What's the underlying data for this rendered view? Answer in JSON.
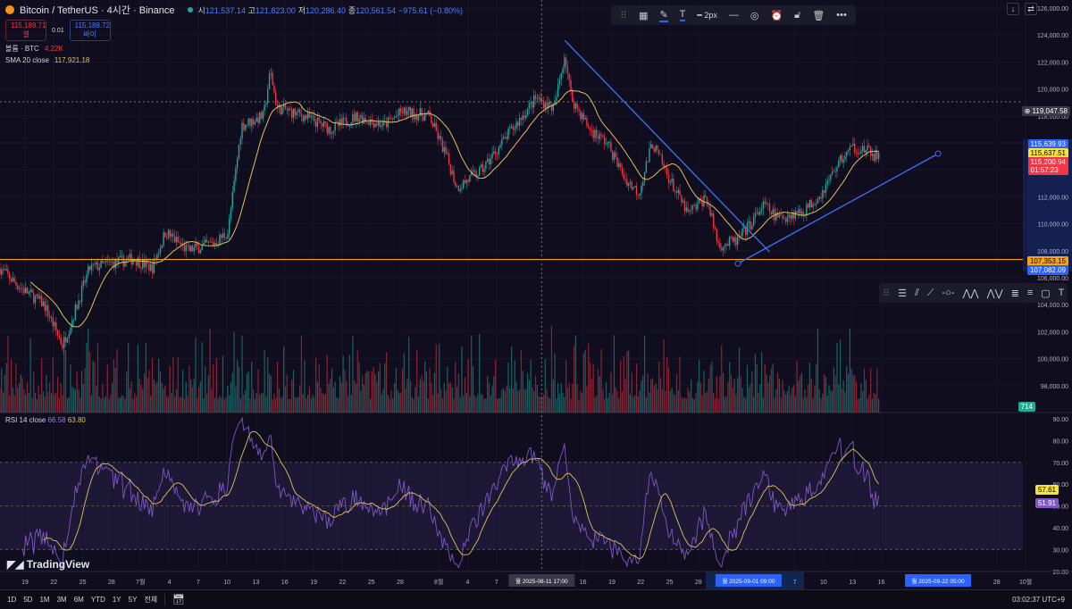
{
  "header": {
    "symbol": "Bitcoin / TetherUS · 4시간 · Binance",
    "ohlc": [
      {
        "k": "시",
        "v": "121,537.14"
      },
      {
        "k": "고",
        "v": "121,823.00"
      },
      {
        "k": "저",
        "v": "120,286.40"
      },
      {
        "k": "종",
        "v": "120,561.54"
      }
    ],
    "change": "−975.61 (−0.80%)",
    "sell_price": "115,188.71",
    "sell_label": "셀",
    "spread": "0.01",
    "buy_price": "115,188.72",
    "buy_label": "바이",
    "volume_label": "볼륨 · BTC",
    "volume_value": "4.22K",
    "sma_label": "SMA 20 close",
    "sma_value": "117,921.18"
  },
  "drawing_toolbar": {
    "width_label": "2px",
    "icons": [
      "drag-handle",
      "template",
      "pencil",
      "text",
      "line-width",
      "line-style",
      "visibility",
      "alert",
      "lock",
      "trash",
      "more"
    ]
  },
  "draw_tools": [
    "drag-handle",
    "horizontal-lines",
    "parallel-channel",
    "trend-line",
    "horizontal-ray",
    "xabcd-pattern",
    "abcd-pattern",
    "fib-retracement",
    "fib-extension",
    "rectangle",
    "text"
  ],
  "price_axis": {
    "ticks": [
      "126,000.00",
      "124,000.00",
      "122,000.00",
      "120,000.00",
      "118,000.00",
      "116,000.00",
      "114,000.00",
      "112,000.00",
      "110,000.00",
      "108,000.00",
      "106,000.00",
      "104,000.00",
      "102,000.00",
      "100,000.00",
      "98,000.00"
    ],
    "labels": {
      "crosshair": "119,047.58",
      "high": "115,639.93",
      "sma": "115,637.51",
      "last": "115,200.94",
      "countdown": "01:57:23",
      "hline": "107,353.15",
      "low": "107,082.09",
      "volume": "714"
    }
  },
  "rsi": {
    "label": "RSI 14 close",
    "value": "66.58",
    "ma_value": "63.80",
    "ticks": [
      "90.00",
      "80.00",
      "70.00",
      "60.00",
      "50.00",
      "40.00",
      "30.00",
      "20.00"
    ],
    "axis_ma": "57.61",
    "axis_rsi": "51.91"
  },
  "time_axis": {
    "ticks": [
      [
        "19",
        0
      ],
      [
        "22",
        3
      ],
      [
        "25",
        6
      ],
      [
        "28",
        9
      ],
      [
        "7월",
        12
      ],
      [
        "4",
        15
      ],
      [
        "7",
        18
      ],
      [
        "10",
        21
      ],
      [
        "13",
        24
      ],
      [
        "16",
        27
      ],
      [
        "19",
        30
      ],
      [
        "22",
        33
      ],
      [
        "25",
        36
      ],
      [
        "28",
        39
      ],
      [
        "8월",
        43
      ],
      [
        "4",
        46
      ],
      [
        "7",
        49
      ],
      [
        "16",
        58
      ],
      [
        "19",
        61
      ],
      [
        "22",
        64
      ],
      [
        "25",
        67
      ],
      [
        "28",
        70
      ],
      [
        "7",
        80
      ],
      [
        "10",
        83
      ],
      [
        "13",
        86
      ],
      [
        "16",
        89
      ],
      [
        "28",
        101
      ],
      [
        "10월",
        104
      ]
    ],
    "highlights": [
      [
        "월 2025-08-11   17:00",
        53.7
      ],
      [
        "월 2025-09-01   09:00",
        75.2
      ],
      [
        "월 2025-09-22   05:00",
        94.9
      ]
    ]
  },
  "bottom": {
    "ranges": [
      "1D",
      "5D",
      "1M",
      "3M",
      "6M",
      "YTD",
      "1Y",
      "5Y",
      "전체"
    ],
    "time": "03:02:37 UTC+9"
  },
  "logo": "TradingView",
  "colors": {
    "up": "#26a69a",
    "down": "#f23645",
    "sma": "#e0c15a",
    "trend": "#3d6ff0",
    "hline": "#f7a21b",
    "rsi": "#7e57c2"
  },
  "chart_data": {
    "type": "candlestick",
    "day0": "2025-06-19",
    "candle_hours": 4,
    "price_path": [
      [
        -2.6,
        106700
      ],
      [
        -0.7,
        105400
      ],
      [
        2.0,
        104000
      ],
      [
        3.9,
        101000
      ],
      [
        4.8,
        102700
      ],
      [
        6.7,
        106700
      ],
      [
        8.5,
        107000
      ],
      [
        11.3,
        107400
      ],
      [
        13.2,
        106700
      ],
      [
        14.6,
        109400
      ],
      [
        16.9,
        108000
      ],
      [
        19.7,
        108600
      ],
      [
        21.1,
        109400
      ],
      [
        22.5,
        117300
      ],
      [
        24.8,
        118000
      ],
      [
        25.5,
        121300
      ],
      [
        26.2,
        118600
      ],
      [
        29.0,
        118000
      ],
      [
        31.8,
        117000
      ],
      [
        34.5,
        118000
      ],
      [
        37.3,
        117300
      ],
      [
        39.2,
        118300
      ],
      [
        42.0,
        118000
      ],
      [
        43.8,
        115000
      ],
      [
        44.9,
        112700
      ],
      [
        47.5,
        114000
      ],
      [
        50.3,
        116700
      ],
      [
        53.1,
        119300
      ],
      [
        55.0,
        118600
      ],
      [
        56.1,
        122600
      ],
      [
        56.8,
        119300
      ],
      [
        58.7,
        117000
      ],
      [
        60.5,
        116000
      ],
      [
        62.4,
        113300
      ],
      [
        63.8,
        112300
      ],
      [
        65.2,
        116000
      ],
      [
        67.0,
        113300
      ],
      [
        68.9,
        110700
      ],
      [
        70.8,
        112000
      ],
      [
        72.1,
        108400
      ],
      [
        74.0,
        108700
      ],
      [
        75.4,
        110000
      ],
      [
        76.8,
        111400
      ],
      [
        78.2,
        110400
      ],
      [
        81.0,
        111000
      ],
      [
        82.8,
        112300
      ],
      [
        84.7,
        114700
      ],
      [
        86.1,
        115700
      ],
      [
        87.5,
        115400
      ],
      [
        88.9,
        114800
      ]
    ],
    "trend_lines": [
      [
        [
          56.1,
          123600
        ],
        [
          77.4,
          107900
        ]
      ],
      [
        [
          74.1,
          107050
        ],
        [
          94.9,
          115200
        ]
      ]
    ],
    "horizontal_line": 107353.15,
    "crosshair": {
      "day": 53.7,
      "price": 119047.58
    },
    "price_range": [
      96500,
      126600
    ],
    "rsi_range": [
      20,
      90
    ],
    "rsi_bands": [
      30,
      70
    ]
  }
}
